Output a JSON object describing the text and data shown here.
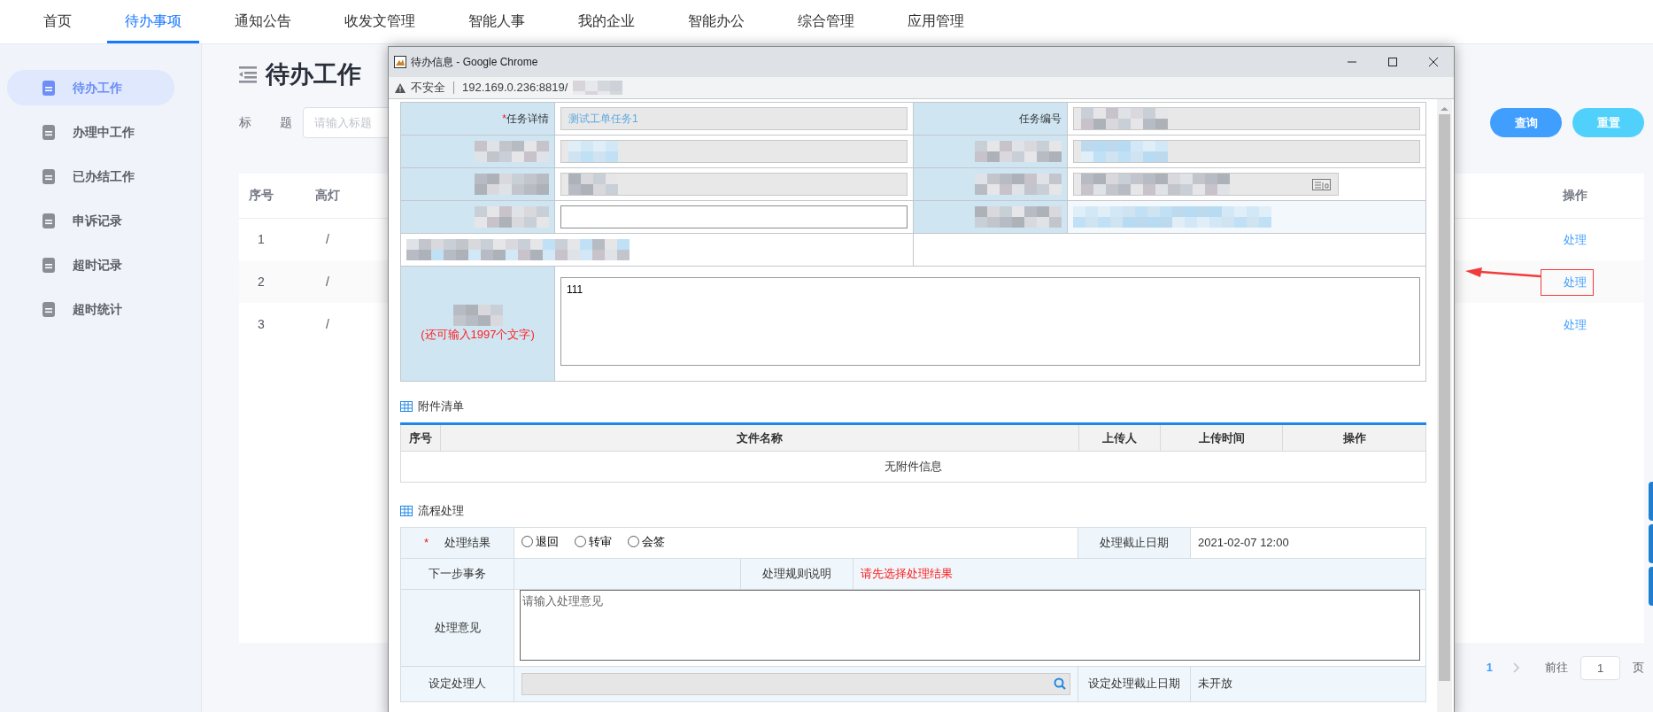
{
  "top_nav": [
    {
      "label": "首页",
      "selected": false
    },
    {
      "label": "待办事项",
      "selected": true
    },
    {
      "label": "通知公告",
      "selected": false
    },
    {
      "label": "收发文管理",
      "selected": false
    },
    {
      "label": "智能人事",
      "selected": false
    },
    {
      "label": "我的企业",
      "selected": false
    },
    {
      "label": "智能办公",
      "selected": false
    },
    {
      "label": "综合管理",
      "selected": false
    },
    {
      "label": "应用管理",
      "selected": false
    }
  ],
  "sidebar": {
    "items": [
      {
        "label": "待办工作",
        "selected": true
      },
      {
        "label": "办理中工作",
        "selected": false
      },
      {
        "label": "已办结工作",
        "selected": false
      },
      {
        "label": "申诉记录",
        "selected": false
      },
      {
        "label": "超时记录",
        "selected": false
      },
      {
        "label": "超时统计",
        "selected": false
      }
    ]
  },
  "page": {
    "title": "待办工作",
    "search": {
      "label": "标 题",
      "placeholder": "请输入标题"
    },
    "buttons": [
      {
        "label": "查询",
        "kind": "primary"
      },
      {
        "label": "重置",
        "kind": "info"
      }
    ],
    "table": {
      "columns": [
        "序号",
        "高灯",
        "操作"
      ],
      "rows": [
        {
          "index": "1",
          "light": "/",
          "action": "处理",
          "marked": false
        },
        {
          "index": "2",
          "light": "/",
          "action": "处理",
          "marked": true
        },
        {
          "index": "3",
          "light": "/",
          "action": "处理",
          "marked": false
        }
      ]
    },
    "pagination": {
      "current": "1",
      "goto_label": "前往",
      "goto_value": "1",
      "page_suffix": "页"
    }
  },
  "popup": {
    "title": "待办信息 - Google Chrome",
    "security": "不安全",
    "url": "192.169.0.236:8819/",
    "detail_rows": [
      [
        {
          "kind": "label",
          "mark": "*",
          "text": "任务详情"
        },
        {
          "kind": "readonly",
          "value": "测试工单任务1"
        },
        {
          "kind": "label",
          "text": "任务编号"
        },
        {
          "kind": "readonly-pixelated"
        }
      ],
      [
        {
          "kind": "label-pixelated"
        },
        {
          "kind": "readonly-pixelated"
        },
        {
          "kind": "label-pixelated"
        },
        {
          "kind": "readonly-pixelated"
        }
      ],
      [
        {
          "kind": "label-pixelated"
        },
        {
          "kind": "readonly-pixelated"
        },
        {
          "kind": "label-pixelated"
        },
        {
          "kind": "date-pixelated"
        }
      ],
      [
        {
          "kind": "label-pixelated"
        },
        {
          "kind": "input"
        },
        {
          "kind": "label-pixelated"
        },
        {
          "kind": "text-pixelated"
        }
      ],
      [
        {
          "kind": "wide-pixelated"
        },
        {
          "kind": "empty"
        }
      ]
    ],
    "remark": {
      "hint": "(还可输入1997个文字)",
      "value": "111"
    },
    "attachments": {
      "title": "附件清单",
      "columns": [
        "序号",
        "文件名称",
        "上传人",
        "上传时间",
        "操作"
      ],
      "empty": "无附件信息"
    },
    "process": {
      "title": "流程处理",
      "result": {
        "mark": "*",
        "label": "处理结果",
        "options": [
          {
            "label": "退回",
            "selected": false
          },
          {
            "label": "转审",
            "selected": false
          },
          {
            "label": "会签",
            "selected": false
          }
        ]
      },
      "deadline": {
        "label": "处理截止日期",
        "value": "2021-02-07 12:00"
      },
      "next": {
        "label": "下一步事务"
      },
      "rule": {
        "label": "处理规则说明",
        "value": "请先选择处理结果"
      },
      "opinion": {
        "label": "处理意见",
        "placeholder": "请输入处理意见"
      },
      "assignee": {
        "label": "设定处理人"
      },
      "assignee_deadline": {
        "label": "设定处理截止日期",
        "value": "未开放"
      }
    }
  }
}
